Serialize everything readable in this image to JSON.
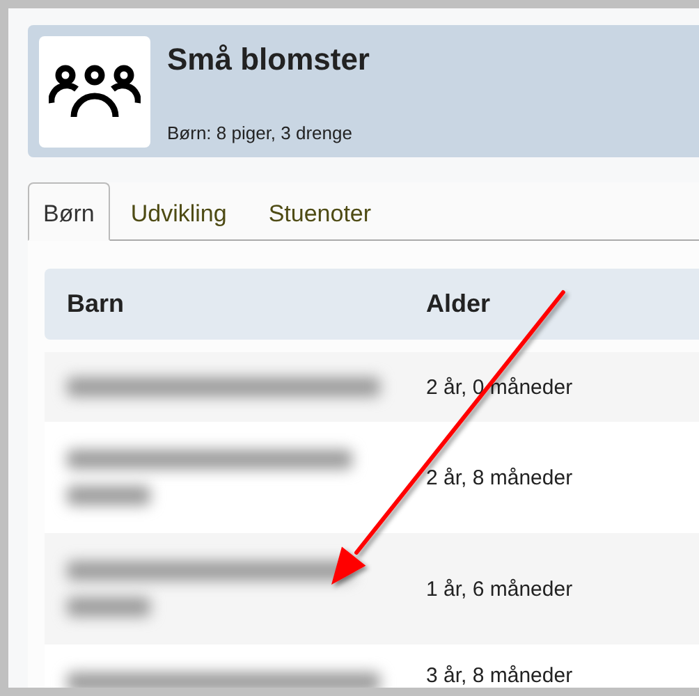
{
  "group": {
    "title": "Små blomster",
    "subtitle": "Børn: 8 piger, 3 drenge"
  },
  "tabs": [
    {
      "label": "Børn",
      "selected": true
    },
    {
      "label": "Udvikling",
      "selected": false
    },
    {
      "label": "Stuenoter",
      "selected": false
    }
  ],
  "table": {
    "columns": [
      "Barn",
      "Alder"
    ],
    "rows": [
      {
        "name": {
          "kind": "blurred-short"
        },
        "age": "2 år, 0 måneder"
      },
      {
        "name": {
          "kind": "blurred-wrapped"
        },
        "age": "2 år, 8 måneder"
      },
      {
        "name": {
          "kind": "blurred-wrapped"
        },
        "age": "1 år, 6 måneder"
      },
      {
        "name": {
          "kind": "blurred-short"
        },
        "age": "3 år, 8 måneder"
      }
    ]
  }
}
